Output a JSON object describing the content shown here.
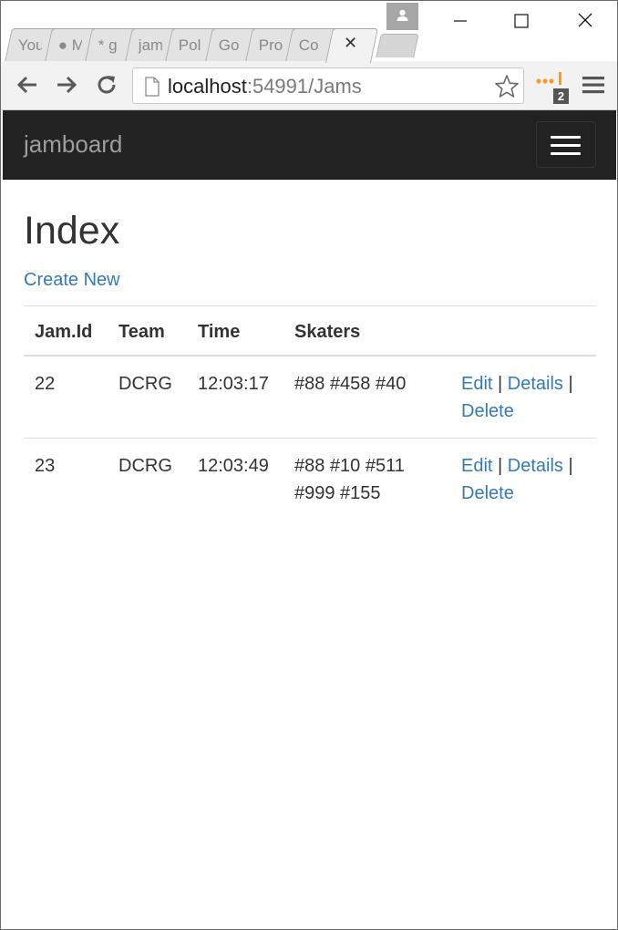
{
  "browser": {
    "tabs": [
      {
        "label": "You"
      },
      {
        "label": "● M"
      },
      {
        "label": "* g"
      },
      {
        "label": "jam"
      },
      {
        "label": "Pol"
      },
      {
        "label": "Go"
      },
      {
        "label": "Pro"
      },
      {
        "label": "Co"
      }
    ],
    "active_tab_close": "✕",
    "url_host": "localhost",
    "url_path": ":54991/Jams",
    "extension_badge": "2"
  },
  "app": {
    "brand": "jamboard"
  },
  "page": {
    "title": "Index",
    "create_link": "Create New",
    "columns": [
      "Jam.Id",
      "Team",
      "Time",
      "Skaters"
    ],
    "rows": [
      {
        "id": "22",
        "team": "DCRG",
        "time": "12:03:17",
        "skaters": "#88 #458 #40",
        "edit": "Edit",
        "details": "Details",
        "delete": "Delete",
        "sep": "|"
      },
      {
        "id": "23",
        "team": "DCRG",
        "time": "12:03:49",
        "skaters": "#88 #10 #511 #999 #155",
        "edit": "Edit",
        "details": "Details",
        "delete": "Delete",
        "sep": "|"
      }
    ]
  },
  "colors": {
    "navbar_bg": "#222222",
    "brand_text": "#9d9d9d",
    "link": "#337ab7",
    "text": "#333333"
  }
}
